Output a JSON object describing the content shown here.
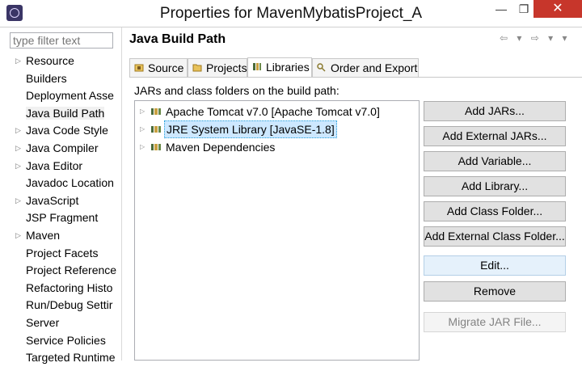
{
  "window": {
    "title": "Properties for MavenMybatisProject_A",
    "minimize_glyph": "—",
    "maximize_glyph": "❐",
    "close_glyph": "✕"
  },
  "filter": {
    "placeholder": "type filter text",
    "value": ""
  },
  "nav": {
    "items": [
      {
        "label": "Resource",
        "expandable": true
      },
      {
        "label": "Builders",
        "expandable": false
      },
      {
        "label": "Deployment Asse",
        "expandable": false
      },
      {
        "label": "Java Build Path",
        "expandable": false,
        "selected": true
      },
      {
        "label": "Java Code Style",
        "expandable": true
      },
      {
        "label": "Java Compiler",
        "expandable": true
      },
      {
        "label": "Java Editor",
        "expandable": true
      },
      {
        "label": "Javadoc Location",
        "expandable": false
      },
      {
        "label": "JavaScript",
        "expandable": true
      },
      {
        "label": "JSP Fragment",
        "expandable": false
      },
      {
        "label": "Maven",
        "expandable": true
      },
      {
        "label": "Project Facets",
        "expandable": false
      },
      {
        "label": "Project Reference",
        "expandable": false
      },
      {
        "label": "Refactoring Histo",
        "expandable": false
      },
      {
        "label": "Run/Debug Settir",
        "expandable": false
      },
      {
        "label": "Server",
        "expandable": false
      },
      {
        "label": "Service Policies",
        "expandable": false
      },
      {
        "label": "Targeted Runtime",
        "expandable": false
      }
    ]
  },
  "page": {
    "heading": "Java Build Path",
    "nav_tools": "⇦ ▾ ⇨ ▾ ▾"
  },
  "tabs": [
    {
      "label": "Source"
    },
    {
      "label": "Projects"
    },
    {
      "label": "Libraries",
      "active": true
    },
    {
      "label": "Order and Export"
    }
  ],
  "libraries": {
    "caption": "JARs and class folders on the build path:",
    "entries": [
      {
        "label": "Apache Tomcat v7.0 [Apache Tomcat v7.0]"
      },
      {
        "label": "JRE System Library [JavaSE-1.8]",
        "selected": true
      },
      {
        "label": "Maven Dependencies"
      }
    ]
  },
  "buttons": {
    "add_jars": "Add JARs...",
    "add_external_jars": "Add External JARs...",
    "add_variable": "Add Variable...",
    "add_library": "Add Library...",
    "add_class_folder": "Add Class Folder...",
    "add_external_class_folder": "Add External Class Folder...",
    "edit": "Edit...",
    "remove": "Remove",
    "migrate_jar": "Migrate JAR File..."
  },
  "colors": {
    "selection": "#cde8ff",
    "close_button": "#c7362b"
  }
}
